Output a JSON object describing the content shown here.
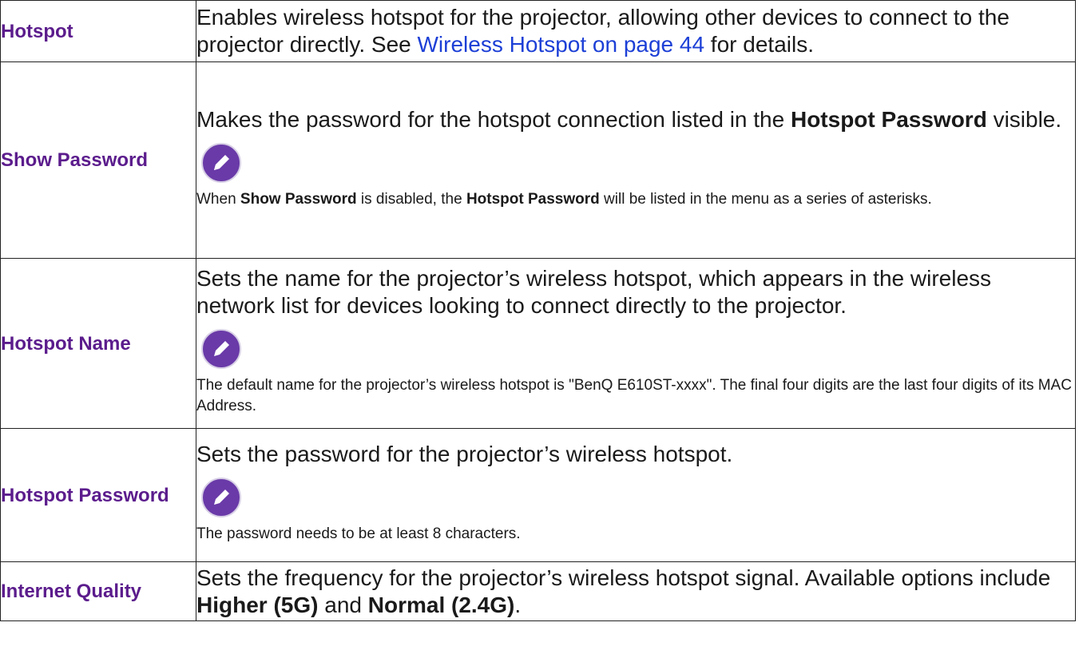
{
  "rows": [
    {
      "label": "Hotspot",
      "desc": {
        "pre": "Enables wireless hotspot for the projector, allowing other devices to connect to the projector directly. See ",
        "link": "Wireless Hotspot on page 44",
        "post": " for details."
      }
    },
    {
      "label": "Show Password",
      "desc": {
        "pre": "Makes the password for the hotspot connection listed in the ",
        "bold1": "Hotspot Password",
        "post": " visible."
      },
      "note": {
        "t1": "When ",
        "b1": "Show Password",
        "t2": " is disabled, the ",
        "b2": "Hotspot Password",
        "t3": " will be listed in the menu as a series of asterisks."
      }
    },
    {
      "label": "Hotspot Name",
      "desc": {
        "text": "Sets the name for the projector’s wireless hotspot, which appears in the wireless network list for devices looking to connect directly to the projector."
      },
      "note": {
        "text": "The default name for the projector’s wireless hotspot is \"BenQ E610ST-xxxx\". The final four digits are the last four digits of its MAC Address."
      }
    },
    {
      "label": "Hotspot Password",
      "desc": {
        "text": "Sets the password for the projector’s wireless hotspot."
      },
      "note": {
        "text": "The password needs to be at least 8 characters."
      }
    },
    {
      "label": "Internet Quality",
      "desc": {
        "pre": "Sets the frequency for the projector’s wireless hotspot signal. Available options include ",
        "bold1": "Higher (5G)",
        "mid": " and ",
        "bold2": "Normal (2.4G)",
        "post": "."
      }
    }
  ],
  "colors": {
    "label": "#5b1c8c",
    "link": "#1c3fd6",
    "note_icon_bg": "#6a3aa8",
    "border": "#222222"
  },
  "icons": {
    "note": "pencil-note-icon"
  }
}
